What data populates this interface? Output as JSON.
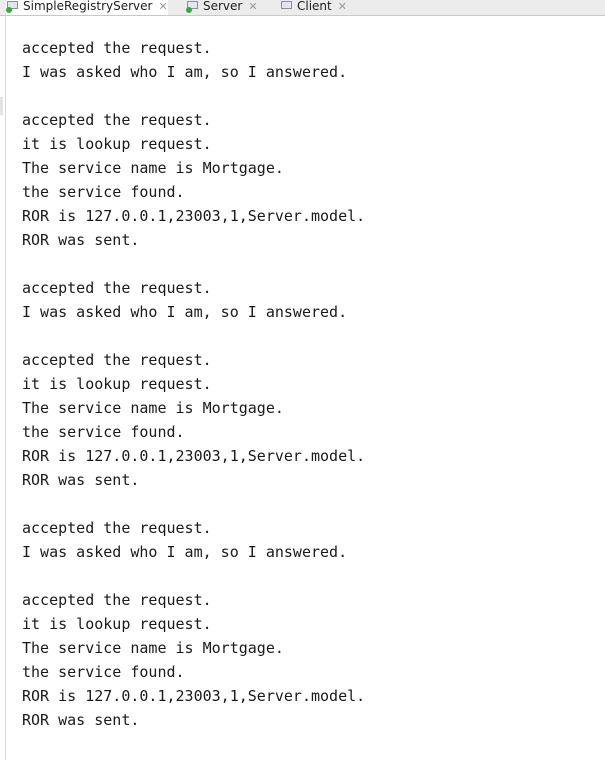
{
  "tabs": [
    {
      "label": "SimpleRegistryServer",
      "active": true
    },
    {
      "label": "Server",
      "active": false
    },
    {
      "label": "Client",
      "active": false
    }
  ],
  "icons": {
    "tab_icon": "console-run-icon",
    "close": "close-icon"
  },
  "console": {
    "lines": [
      "accepted the request.",
      "I was asked who I am, so I answered.",
      "",
      "accepted the request.",
      "it is lookup request.",
      "The service name is Mortgage.",
      "the service found.",
      "ROR is 127.0.0.1,23003,1,Server.model.",
      "ROR was sent.",
      "",
      "accepted the request.",
      "I was asked who I am, so I answered.",
      "",
      "accepted the request.",
      "it is lookup request.",
      "The service name is Mortgage.",
      "the service found.",
      "ROR is 127.0.0.1,23003,1,Server.model.",
      "ROR was sent.",
      "",
      "accepted the request.",
      "I was asked who I am, so I answered.",
      "",
      "accepted the request.",
      "it is lookup request.",
      "The service name is Mortgage.",
      "the service found.",
      "ROR is 127.0.0.1,23003,1,Server.model.",
      "ROR was sent."
    ]
  }
}
